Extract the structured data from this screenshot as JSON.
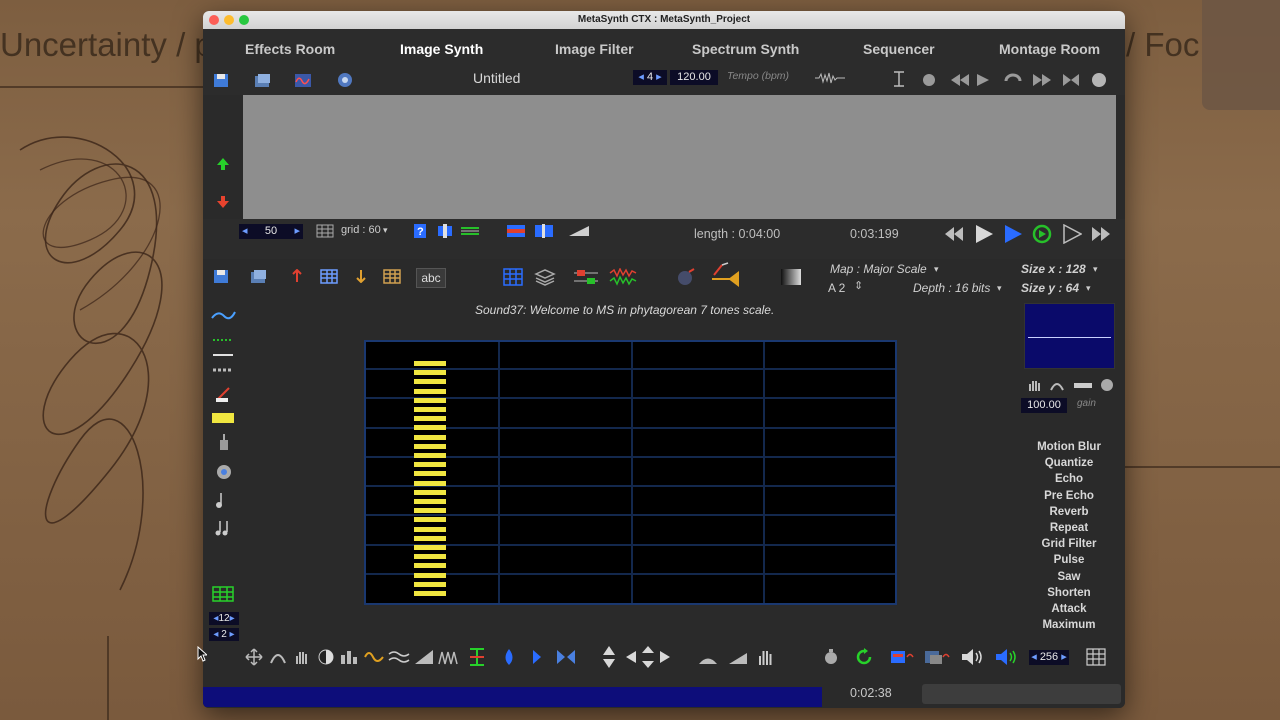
{
  "desktop": {
    "left_text": "Uncertainty / p",
    "right_text": "/ Foc"
  },
  "window": {
    "title": "MetaSynth CTX : MetaSynth_Project"
  },
  "menu": {
    "items": [
      {
        "label": "Effects Room",
        "active": false
      },
      {
        "label": "Image Synth",
        "active": true
      },
      {
        "label": "Image Filter",
        "active": false
      },
      {
        "label": "Spectrum Synth",
        "active": false
      },
      {
        "label": "Sequencer",
        "active": false
      },
      {
        "label": "Montage Room",
        "active": false
      }
    ]
  },
  "top_toolbar": {
    "doc_title": "Untitled",
    "beats": "4",
    "tempo": "120.00",
    "tempo_label": "Tempo (bpm)"
  },
  "transport": {
    "zoom": "50",
    "grid_label": "grid : 60",
    "length_label": "length : 0:04:00",
    "position": "0:03:199"
  },
  "image_synth": {
    "map_label": "Map : Major Scale",
    "base_note": "A 2",
    "depth_label": "Depth : 16 bits",
    "size_x_label": "Size x : 128",
    "size_y_label": "Size y : 64",
    "message": "Sound37: Welcome to MS in phytagorean 7 tones scale.",
    "abc_label": "abc",
    "gain_value": "100.00",
    "gain_label": "gain",
    "left_spin_top": "12",
    "left_spin_bottom": "2",
    "bottom_value": "256"
  },
  "effects": [
    "Motion Blur",
    "Quantize",
    "Echo",
    "Pre Echo",
    "Reverb",
    "Repeat",
    "Grid Filter",
    "Pulse",
    "Saw",
    "Shorten",
    "Attack",
    "Maximum"
  ],
  "status": {
    "time": "0:02:38",
    "progress": 1.0
  },
  "colors": {
    "accent_blue": "#2a6cff",
    "note_yellow": "#f0e640",
    "green": "#33cc33",
    "red": "#e04030"
  }
}
